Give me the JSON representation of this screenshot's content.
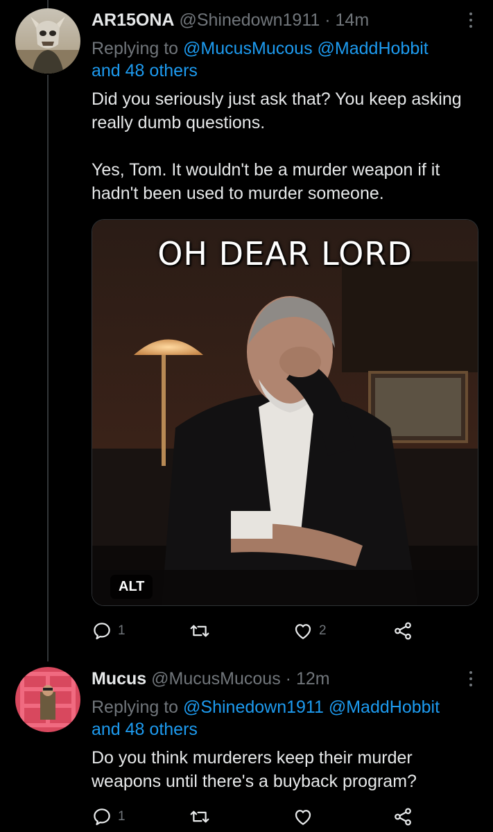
{
  "tweets": [
    {
      "name": "AR15ONA",
      "handle": "@Shinedown1911",
      "separator": "·",
      "time": "14m",
      "replying_prefix": "Replying to ",
      "mentions": [
        "@MucusMucous",
        "@MaddHobbit"
      ],
      "others": "and 48 others",
      "text": "Did you seriously just ask that? You keep asking really dumb questions.\n\nYes, Tom. It wouldn't be a murder weapon if it hadn't been used to murder someone.",
      "media": {
        "caption": "OH DEAR LORD",
        "alt_label": "ALT"
      },
      "actions": {
        "replies": "1",
        "retweets": "",
        "likes": "2"
      }
    },
    {
      "name": "Mucus",
      "handle": "@MucusMucous",
      "separator": "·",
      "time": "12m",
      "replying_prefix": "Replying to ",
      "mentions": [
        "@Shinedown1911",
        "@MaddHobbit"
      ],
      "others": "and 48 others",
      "text": "Do you think murderers keep their murder weapons until there's a buyback program?",
      "actions": {
        "replies": "1",
        "retweets": "",
        "likes": ""
      }
    }
  ],
  "colors": {
    "background": "#000000",
    "text_primary": "#e7e9ea",
    "text_secondary": "#71767b",
    "link": "#1d9bf0",
    "divider": "#333639"
  },
  "icons": {
    "reply": "reply-icon",
    "retweet": "retweet-icon",
    "like": "heart-icon",
    "share": "share-icon",
    "more": "more-options-icon"
  }
}
